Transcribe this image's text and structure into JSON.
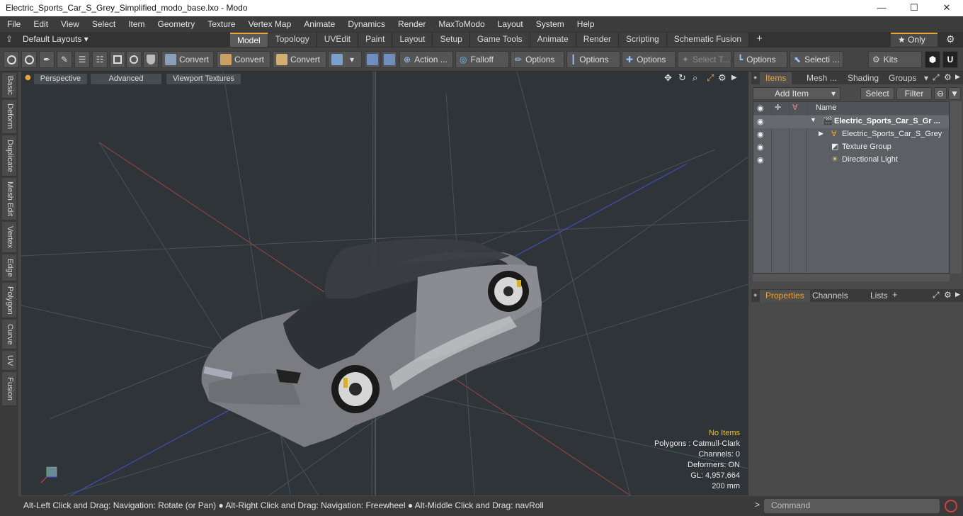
{
  "window": {
    "title": "Electric_Sports_Car_S_Grey_Simplified_modo_base.lxo - Modo",
    "minimize": "—",
    "maximize": "☐",
    "close": "✕"
  },
  "menu": [
    "File",
    "Edit",
    "View",
    "Select",
    "Item",
    "Geometry",
    "Texture",
    "Vertex Map",
    "Animate",
    "Dynamics",
    "Render",
    "MaxToModo",
    "Layout",
    "System",
    "Help"
  ],
  "layout": {
    "selector": "Default Layouts ▾",
    "tabs": [
      "Model",
      "Topology",
      "UVEdit",
      "Paint",
      "Layout",
      "Setup",
      "Game Tools",
      "Animate",
      "Render",
      "Scripting",
      "Schematic Fusion"
    ],
    "active_tab": "Model",
    "add_tab": "+",
    "only": "★  Only"
  },
  "toolbar": {
    "convert1": "Convert",
    "convert2": "Convert",
    "convert3": "Convert",
    "action": "Action  ...",
    "falloff": "Falloff",
    "options1": "Options",
    "options2": "Options",
    "options3": "Options",
    "select_t": "Select T...",
    "options4": "Options",
    "selecti": "Selecti ...",
    "kits": "Kits"
  },
  "left_tabs": [
    "Basic",
    "Deform",
    "Duplicate",
    "Mesh Edit",
    "Vertex",
    "Edge",
    "Polygon",
    "Curve",
    "UV",
    "Fusion"
  ],
  "viewport": {
    "perspective": "Perspective",
    "advanced": "Advanced",
    "textures": "Viewport Textures",
    "info": {
      "no_items": "No Items",
      "polygons": "Polygons : Catmull-Clark",
      "channels": "Channels: 0",
      "deformers": "Deformers: ON",
      "gl": "GL: 4,957,664",
      "scale": "200 mm"
    }
  },
  "items_panel": {
    "tabs": [
      "Items",
      "Mesh ...",
      "Shading",
      "Groups"
    ],
    "add_item": "Add Item",
    "select": "Select",
    "filter": "Filter",
    "name_header": "Name",
    "rows": [
      {
        "label": "Electric_Sports_Car_S_Gr ...",
        "type": "scene"
      },
      {
        "label": "Electric_Sports_Car_S_Grey ...",
        "type": "mesh"
      },
      {
        "label": "Texture Group",
        "type": "texture"
      },
      {
        "label": "Directional Light",
        "type": "light"
      }
    ]
  },
  "properties_panel": {
    "tabs": [
      "Properties",
      "Channels",
      "Lists"
    ],
    "add": "+"
  },
  "status": {
    "hint": "Alt-Left Click and Drag: Navigation: Rotate (or Pan) ●  Alt-Right Click and Drag: Navigation: Freewheel ●  Alt-Middle Click and Drag: navRoll",
    "prompt": ">",
    "command_placeholder": "Command"
  },
  "colors": {
    "accent": "#e8a434",
    "viewport_bg": "#2e3438",
    "car_body": "#7a7b80"
  }
}
